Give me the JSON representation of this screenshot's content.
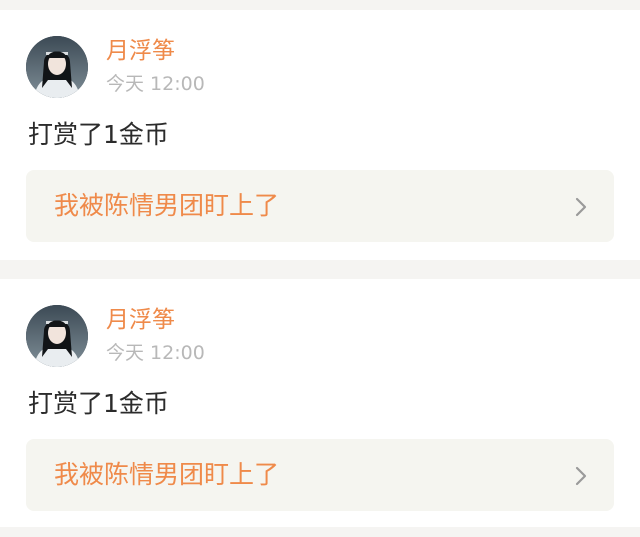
{
  "feed": {
    "posts": [
      {
        "username": "月浮筝",
        "timestamp": "今天 12:00",
        "action": "打赏了1金币",
        "link_title": "我被陈情男团盯上了",
        "avatar_icon": "user-avatar",
        "chevron_icon": "chevron-right-icon"
      },
      {
        "username": "月浮筝",
        "timestamp": "今天 12:00",
        "action": "打赏了1金币",
        "link_title": "我被陈情男团盯上了",
        "avatar_icon": "user-avatar",
        "chevron_icon": "chevron-right-icon"
      }
    ]
  },
  "colors": {
    "accent": "#ef8a4a",
    "muted_text": "#b8b8b8",
    "body_text": "#2b2b2b",
    "page_background": "#f5f4f2",
    "link_box_background": "#f5f5f0"
  }
}
